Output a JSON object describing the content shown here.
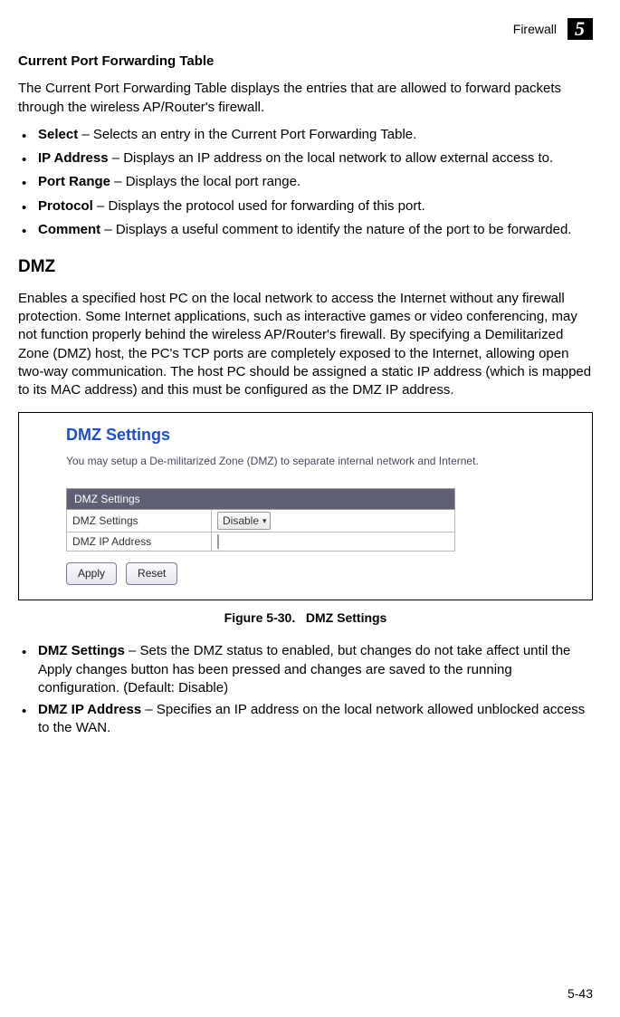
{
  "header": {
    "section": "Firewall",
    "chapter": "5"
  },
  "section1": {
    "title": "Current Port Forwarding Table",
    "intro": "The Current Port Forwarding Table displays the entries that are allowed to forward packets through the wireless AP/Router's firewall.",
    "items": [
      {
        "term": "Select",
        "desc": " – Selects an entry in the Current Port Forwarding Table."
      },
      {
        "term": "IP Address",
        "desc": " – Displays an IP address on the local network to allow external access to."
      },
      {
        "term": "Port Range",
        "desc": " – Displays the local port range."
      },
      {
        "term": "Protocol",
        "desc": " – Displays the protocol used for forwarding of this port."
      },
      {
        "term": "Comment",
        "desc": " – Displays a useful comment to identify the nature of the port to be forwarded."
      }
    ]
  },
  "dmz": {
    "heading": "DMZ",
    "para": "Enables a specified host PC on the local network to access the Internet without any firewall protection. Some Internet applications, such as interactive games or video conferencing, may not function properly behind the wireless AP/Router's firewall. By specifying a Demilitarized Zone (DMZ) host, the PC's TCP ports are completely exposed to the Internet, allowing open two-way communication. The host PC should be assigned a static IP address (which is mapped to its MAC address) and this must be configured as the DMZ IP address."
  },
  "figure": {
    "title": "DMZ Settings",
    "desc": "You may setup a De-militarized Zone (DMZ) to separate internal network and Internet.",
    "table_header": "DMZ Settings",
    "row1_label": "DMZ Settings",
    "row1_value": "Disable",
    "row2_label": "DMZ IP Address",
    "apply": "Apply",
    "reset": "Reset",
    "caption_label": "Figure 5-30.",
    "caption_text": "DMZ Settings"
  },
  "postlist": [
    {
      "term": "DMZ Settings",
      "desc": " – Sets the DMZ status to enabled, but changes do not take affect until the Apply changes button has been pressed and changes are saved to the running configuration. (Default: Disable)"
    },
    {
      "term": "DMZ IP Address",
      "desc": " – Specifies an IP address on the local network allowed unblocked access to the WAN."
    }
  ],
  "page_number": "5-43"
}
